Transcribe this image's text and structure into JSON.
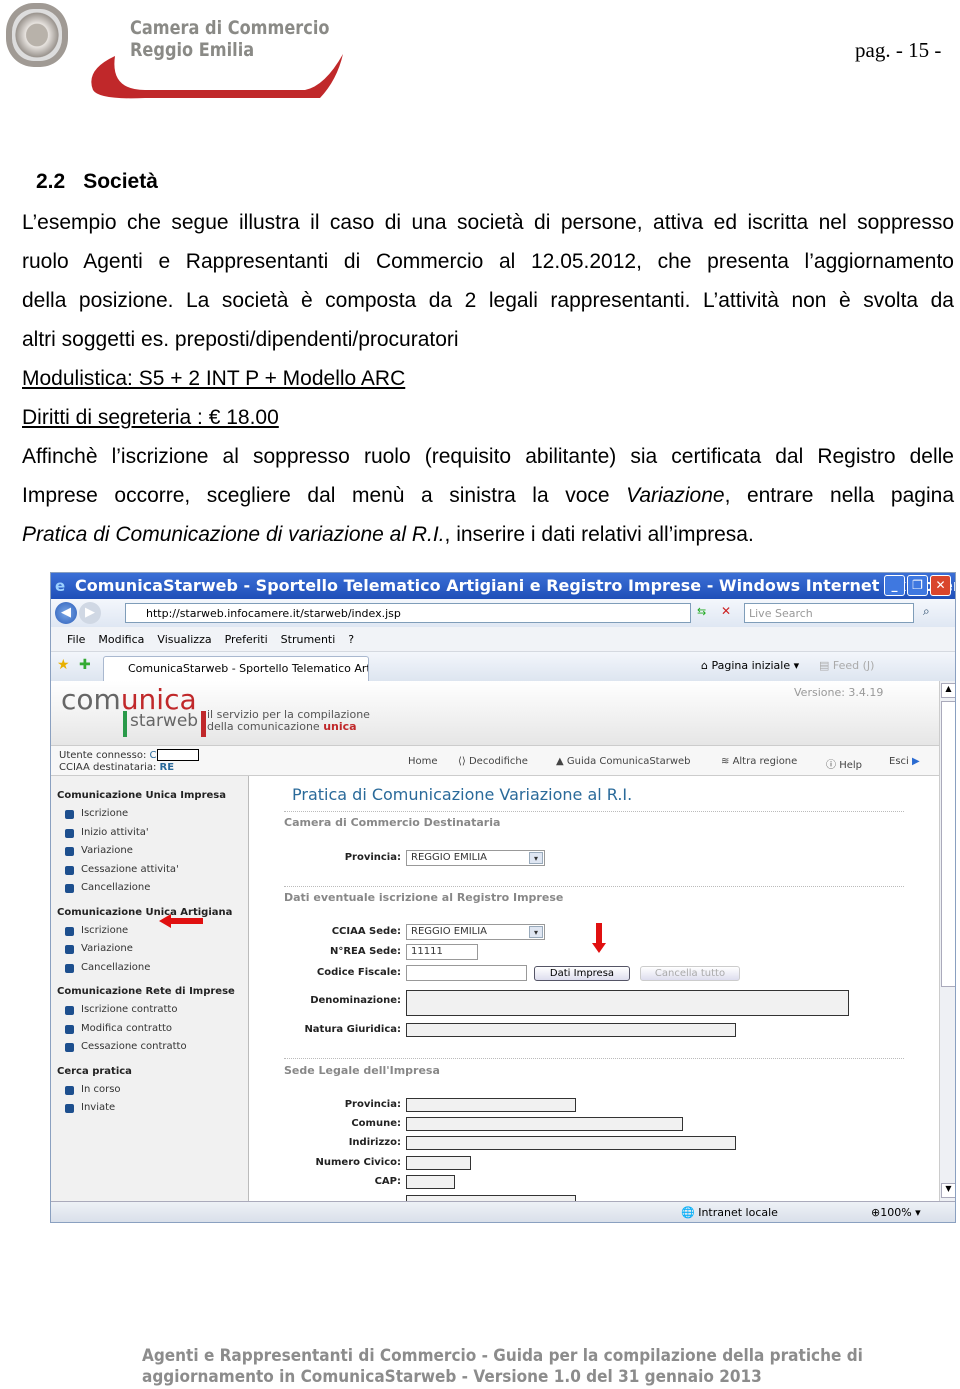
{
  "header": {
    "logo_text_line1": "Camera di Commercio",
    "logo_text_line2": "Reggio Emilia",
    "page_number": "pag. - 15 -"
  },
  "section": {
    "number": "2.2",
    "title": "Società"
  },
  "intro_lines": [
    "L’esempio che segue illustra il caso di una società di persone, attiva ed iscritta nel soppresso",
    "ruolo Agenti e Rappresentanti di Commercio al 12.05.2012, che presenta l’aggiornamento",
    "della posizione. La società è composta da 2 legali rappresentanti. L’attività non è svolta  da",
    "altri soggetti es. preposti/dipendenti/procuratori"
  ],
  "modulistica": "Modulistica: S5 + 2 INT P + Modello ARC",
  "diritti": "Diritti di segreteria : € 18.00",
  "para2": {
    "line1": "Affinchè l’iscrizione al soppresso ruolo (requisito abilitante) sia certificata dal Registro delle",
    "line2_a": "Imprese occorre, scegliere dal menù a sinistra la voce ",
    "line2_italic": "Variazione",
    "line2_b": ",  entrare nella pagina",
    "line3_italic": "Pratica di Comunicazione di variazione al R.I.",
    "line3_b": ", inserire i dati relativi all’impresa."
  },
  "browser": {
    "title": "ComunicaStarweb - Sportello Telematico Artigiani e Registro Imprese - Windows Internet Explorer",
    "url": "http://starweb.infocamere.it/starweb/index.jsp",
    "search_placeholder": "Live Search",
    "menu": [
      "File",
      "Modifica",
      "Visualizza",
      "Preferiti",
      "Strumenti",
      "?"
    ],
    "tab_label": "ComunicaStarweb - Sportello Telematico Art...",
    "home_label": "Pagina iniziale",
    "feed_label": "Feed (J)",
    "status_zone": "Intranet locale",
    "zoom": "100%"
  },
  "app": {
    "logo_main_a": "com",
    "logo_main_b": "unica",
    "logo_sub": "starweb",
    "tagline1": "il servizio per la compilazione",
    "tagline2_a": "della comunicazione ",
    "tagline2_b": "unica",
    "version": "Versione: 3.4.19",
    "user_label": "Utente connesso: ",
    "user_value": "C",
    "cciaa_label": "CCIAA destinataria: ",
    "cciaa_value": "RE",
    "topnav": [
      "Home",
      "Decodifiche",
      "Guida ComunicaStarweb",
      "Altra regione",
      "Help",
      "Esci"
    ],
    "sidebar": [
      {
        "title": "Comunicazione Unica Impresa",
        "items": [
          "Iscrizione",
          "Inizio attivita'",
          "Variazione",
          "Cessazione attivita'",
          "Cancellazione"
        ]
      },
      {
        "title": "Comunicazione Unica Artigiana",
        "items": [
          "Iscrizione",
          "Variazione",
          "Cancellazione"
        ]
      },
      {
        "title": "Comunicazione Rete di Imprese",
        "items": [
          "Iscrizione contratto",
          "Modifica contratto",
          "Cessazione contratto"
        ]
      },
      {
        "title": "Cerca pratica",
        "items": [
          "In corso",
          "Inviate"
        ]
      }
    ],
    "page_title": "Pratica di Comunicazione Variazione al R.I.",
    "sect1": "Camera di Commercio Destinataria",
    "provincia_label": "Provincia:",
    "provincia_value": "REGGIO EMILIA",
    "sect2": "Dati eventuale iscrizione al Registro Imprese",
    "cciaa_sede_label": "CCIAA Sede:",
    "cciaa_sede_value": "REGGIO EMILIA",
    "rea_label": "N°REA Sede:",
    "rea_value": "11111",
    "cf_label": "Codice Fiscale:",
    "cf_value": "",
    "dati_impresa_btn": "Dati Impresa",
    "cancella_btn": "Cancella tutto",
    "denominazione_label": "Denominazione:",
    "natura_label": "Natura Giuridica:",
    "sect3": "Sede Legale dell'Impresa",
    "sl_provincia_label": "Provincia:",
    "comune_label": "Comune:",
    "indirizzo_label": "Indirizzo:",
    "civico_label": "Numero Civico:",
    "cap_label": "CAP:"
  },
  "colors": {
    "annotation_arrow": "#e01010",
    "title_blue": "#2a6a9a",
    "logo_red": "#c0282a"
  },
  "footer": {
    "line1": "Agenti e Rappresentanti di Commercio - Guida  per la compilazione della pratiche di",
    "line2": "aggiornamento in ComunicaStarweb -  Versione 1.0 del 31 gennaio 2013"
  }
}
